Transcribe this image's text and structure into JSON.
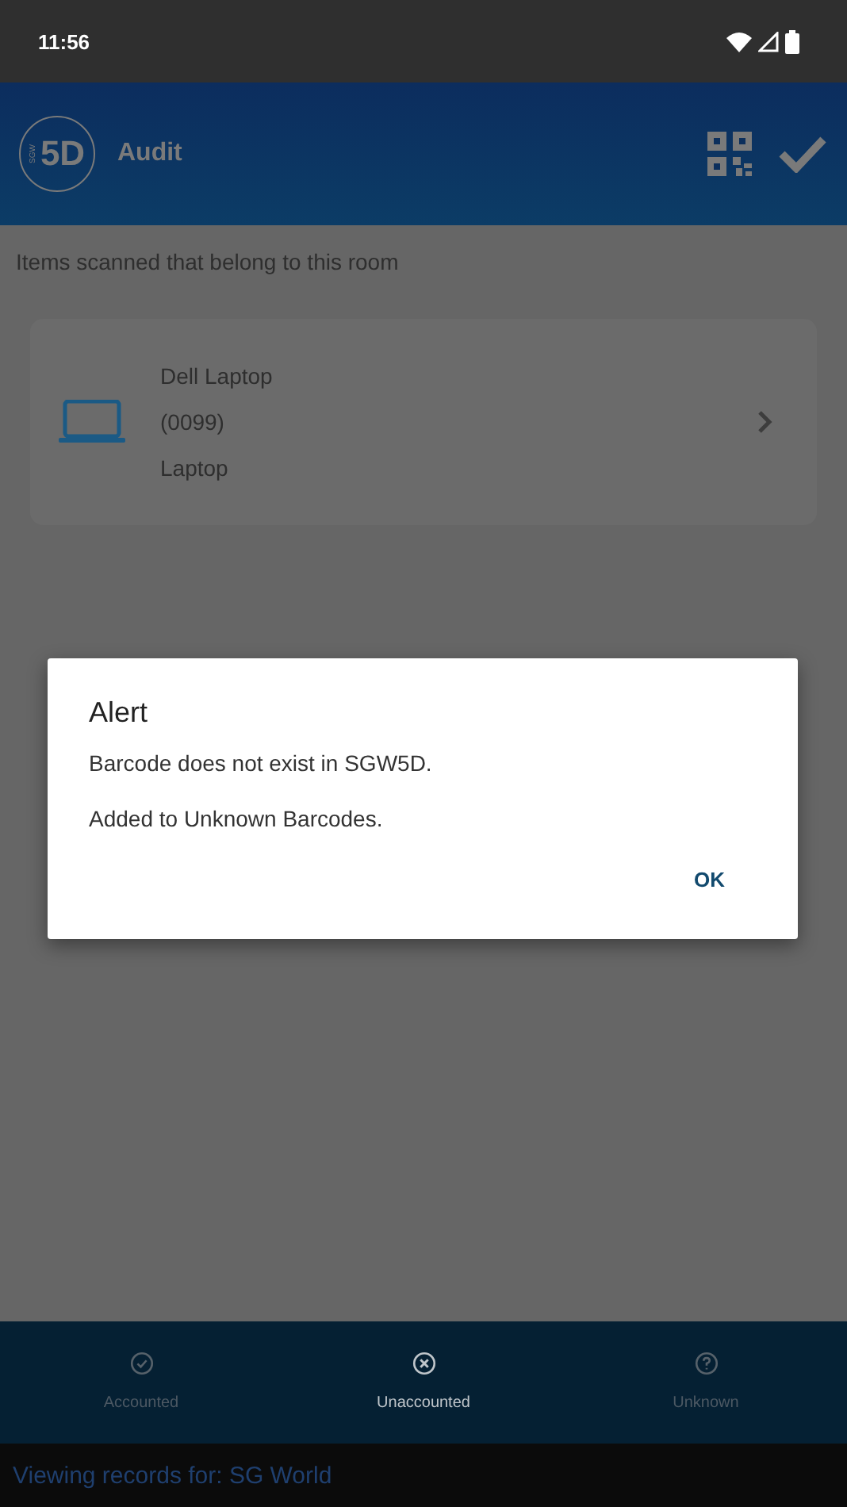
{
  "status_bar": {
    "time": "11:56"
  },
  "app_bar": {
    "logo_small": "SGW",
    "logo_big": "5D",
    "title": "Audit"
  },
  "section_heading": "Items scanned that belong to this room",
  "items": [
    {
      "name": "Dell Laptop",
      "code": "(0099)",
      "type": "Laptop"
    }
  ],
  "dialog": {
    "title": "Alert",
    "lines": [
      "Barcode does not exist in SGW5D.",
      "Added to Unknown Barcodes."
    ],
    "button": "OK"
  },
  "bottom_tabs": [
    {
      "kind": "check",
      "label": "Accounted",
      "selected": false
    },
    {
      "kind": "cross",
      "label": "Unaccounted",
      "selected": true
    },
    {
      "kind": "question",
      "label": "Unknown",
      "selected": false
    }
  ],
  "footer": "Viewing records for: SG World"
}
